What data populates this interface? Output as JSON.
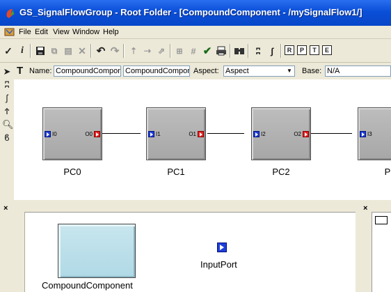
{
  "window": {
    "title": "GS_SignalFlowGroup - Root Folder - [CompoundComponent - /mySignalFlow1/]"
  },
  "menu": [
    "File",
    "Edit",
    "View",
    "Window",
    "Help"
  ],
  "toolbar": {
    "buttons": [
      "check-icon",
      "italic-i-icon",
      "save-icon",
      "copy-icon",
      "paste-icon",
      "delete-icon",
      "undo-icon",
      "redo-icon",
      "pointer-a-icon",
      "pointer-b-icon",
      "pointer-c-icon",
      "grid-a-icon",
      "grid-b-icon",
      "check-link-icon",
      "print-icon",
      "find-icon",
      "zoom-icon",
      "connect-icon"
    ],
    "boxes": [
      "R",
      "P",
      "T",
      "E"
    ]
  },
  "tools": [
    "arrow-tool-icon",
    "connect-tool-icon",
    "disconnect-tool-icon",
    "set-tool-icon",
    "zoom-tool-icon",
    "visualize-tool-icon"
  ],
  "namebar": {
    "name_label": "Name:",
    "name_value": "CompoundCompone",
    "kind_value": "CompoundCompone",
    "aspect_label": "Aspect:",
    "aspect_value": "Aspect",
    "base_label": "Base:",
    "base_value": "N/A"
  },
  "canvas": {
    "components": [
      {
        "label": "PC0",
        "in": "I0",
        "out": "O0"
      },
      {
        "label": "PC1",
        "in": "I1",
        "out": "O1"
      },
      {
        "label": "PC2",
        "in": "I2",
        "out": "O2"
      },
      {
        "label": "P",
        "in": "I3",
        "out": ""
      }
    ]
  },
  "partbrowser": {
    "items": [
      {
        "label": "CompoundComponent"
      },
      {
        "label": "InputPort"
      }
    ]
  },
  "colors": {
    "title_bar": "#0a4fd8",
    "input_port": "#1f3fd8",
    "output_port": "#e82020",
    "compound_fill": "#b0d9e6"
  }
}
